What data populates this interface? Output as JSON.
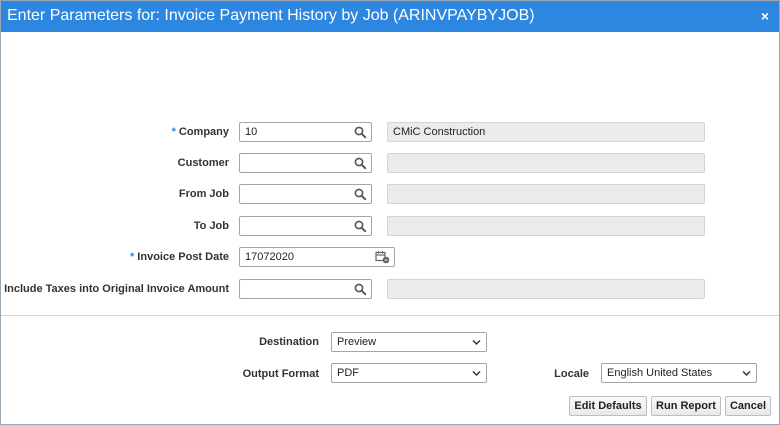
{
  "dialog": {
    "title": "Enter Parameters for: Invoice Payment History by Job (ARINVPAYBYJOB)",
    "close_glyph": "×"
  },
  "required_marker": "*",
  "params": {
    "company": {
      "label": "Company",
      "value": "10",
      "description": "CMiC Construction"
    },
    "customer": {
      "label": "Customer",
      "value": "",
      "description": ""
    },
    "from_job": {
      "label": "From Job",
      "value": "",
      "description": ""
    },
    "to_job": {
      "label": "To Job",
      "value": "",
      "description": ""
    },
    "invoice_post_date": {
      "label": "Invoice Post Date",
      "value": "17072020"
    },
    "include_taxes": {
      "label": "Include Taxes into Original Invoice Amount",
      "value": "",
      "description": ""
    }
  },
  "output": {
    "destination": {
      "label": "Destination",
      "value": "Preview"
    },
    "output_format": {
      "label": "Output Format",
      "value": "PDF"
    },
    "locale": {
      "label": "Locale",
      "value": "English United States"
    }
  },
  "buttons": {
    "edit_defaults": "Edit Defaults",
    "run_report": "Run Report",
    "cancel": "Cancel"
  },
  "icons": {
    "lov": "search-icon",
    "date": "calendar-icon",
    "select": "chevron-down-icon"
  },
  "colors": {
    "titlebar": "#2d86e0",
    "required": "#2d86e0"
  }
}
